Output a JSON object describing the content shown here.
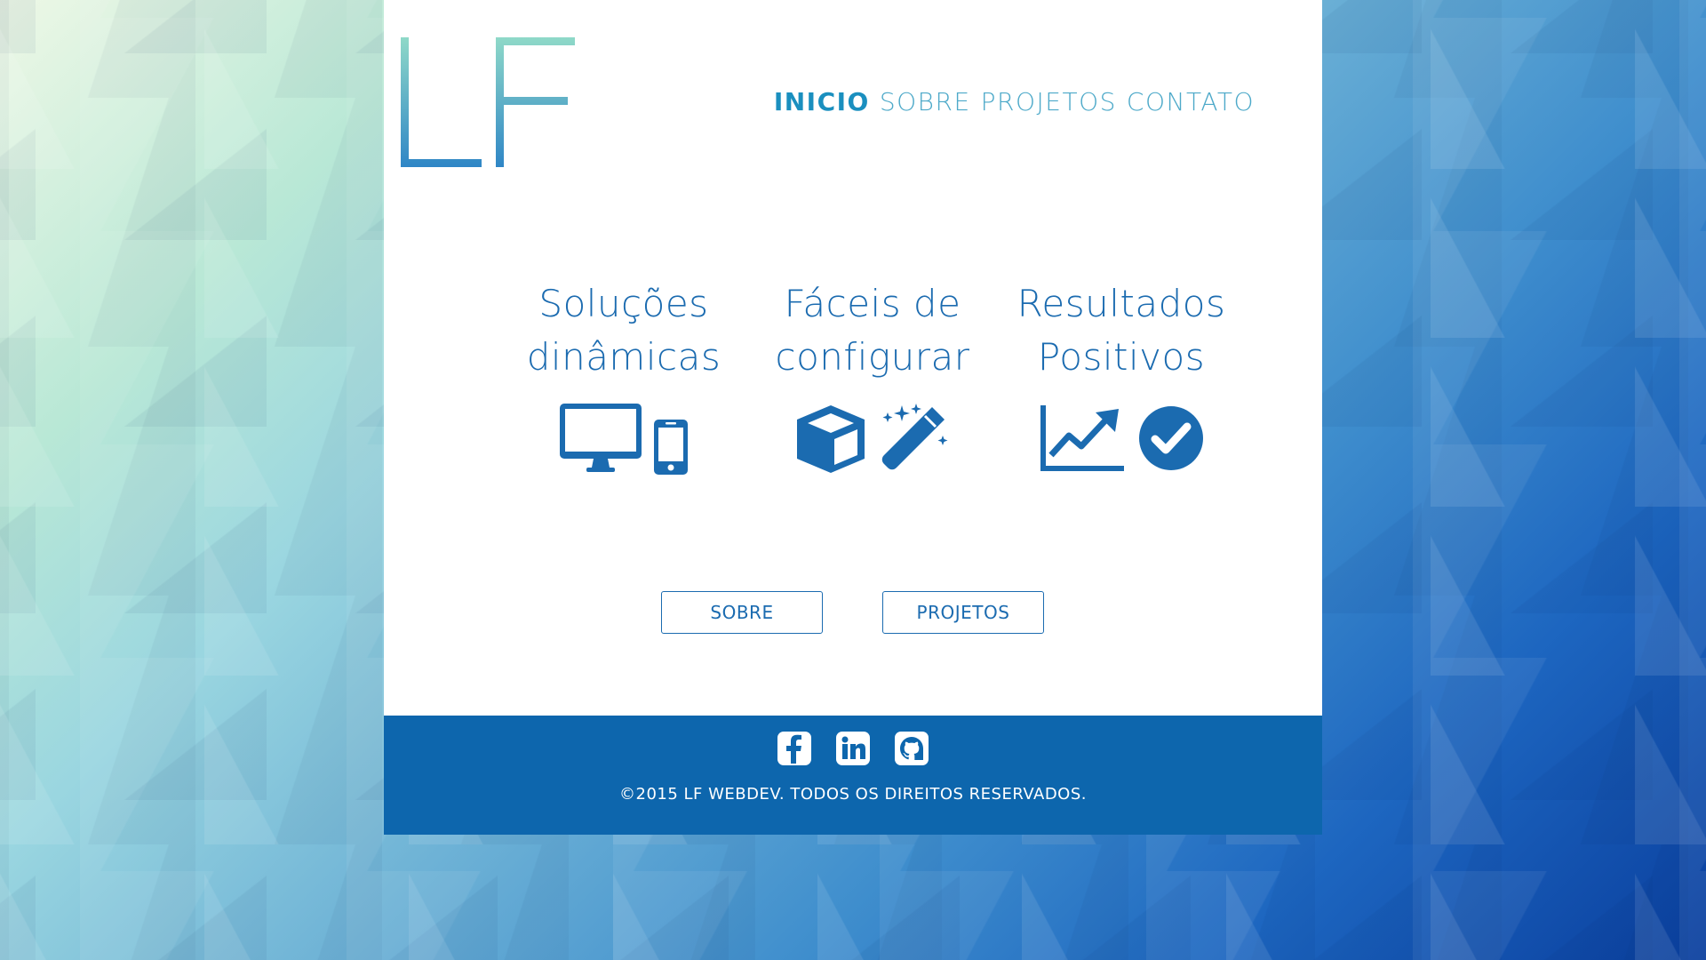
{
  "logo": {
    "text": "LF"
  },
  "nav": {
    "items": [
      {
        "label": "INICIO",
        "active": true
      },
      {
        "label": "SOBRE",
        "active": false
      },
      {
        "label": "PROJETOS",
        "active": false
      },
      {
        "label": "CONTATO",
        "active": false
      }
    ]
  },
  "features": [
    {
      "title": "Soluções\ndinâmicas",
      "icons": [
        "desktop-icon",
        "mobile-phone-icon"
      ]
    },
    {
      "title": "Fáceis de\nconfigurar",
      "icons": [
        "cube-icon",
        "magic-wand-icon"
      ]
    },
    {
      "title": "Resultados\nPositivos",
      "icons": [
        "line-chart-icon",
        "check-circle-icon"
      ]
    }
  ],
  "buttons": {
    "sobre": "SOBRE",
    "projetos": "PROJETOS"
  },
  "footer": {
    "social": [
      "facebook-icon",
      "linkedin-icon",
      "github-icon"
    ],
    "copyright": "©2015 LF WEBDEV. TODOS OS DIREITOS RESERVADOS."
  },
  "colors": {
    "primary": "#1b6bb0",
    "nav": "#4da9c9",
    "footer": "#0d66ad",
    "panel": "#ffffff"
  }
}
